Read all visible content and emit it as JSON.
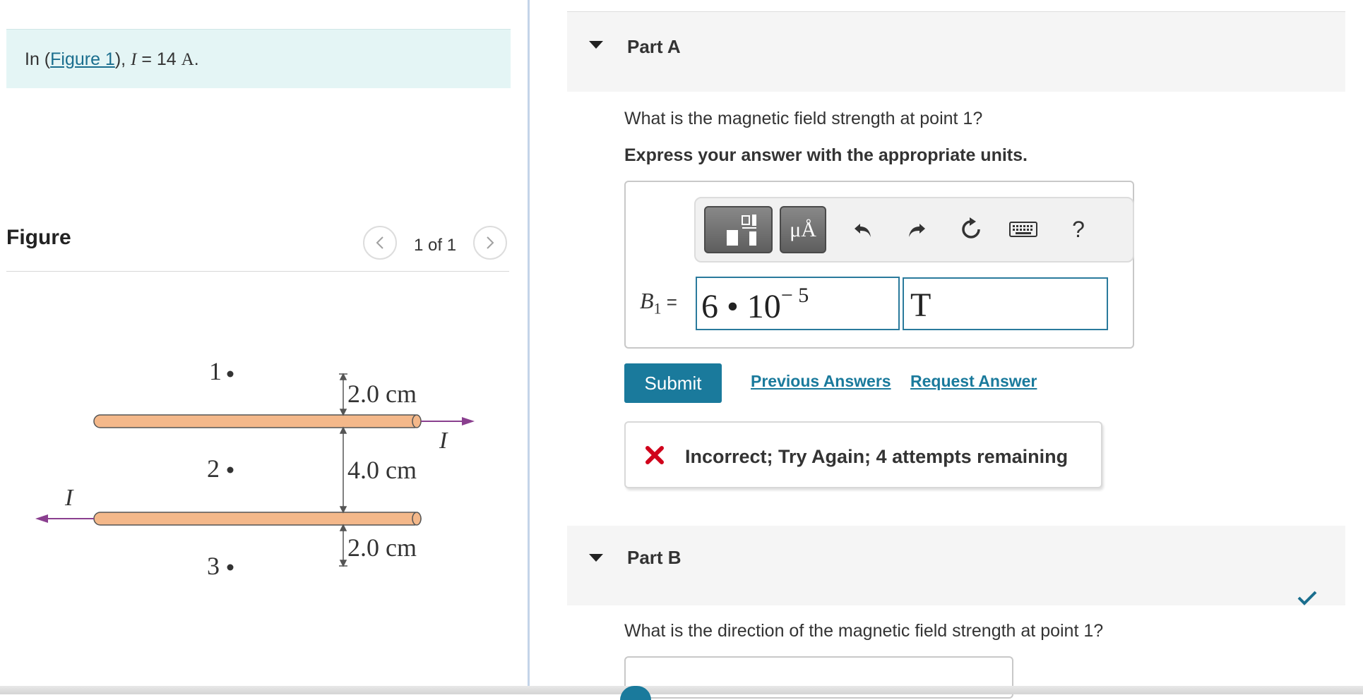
{
  "problem": {
    "prefix": "In (",
    "link": "Figure 1",
    "suffix_open": "), ",
    "var": "I",
    "eq": " = 14 ",
    "unit": "A",
    "period": "."
  },
  "figure": {
    "heading": "Figure",
    "pager": "1 of 1",
    "labels": {
      "point1": "1",
      "point2": "2",
      "point3": "3",
      "dim_top": "2.0 cm",
      "dim_mid": "4.0 cm",
      "dim_bottom": "2.0 cm",
      "current_right": "I",
      "current_left": "I"
    }
  },
  "part_a": {
    "title": "Part A",
    "question": "What is the magnetic field strength at point 1?",
    "instruction": "Express your answer with the appropriate units.",
    "toolbar": {
      "units_label": "μÅ",
      "help_label": "?"
    },
    "variable": "B",
    "subscript": "1",
    "equals": " =",
    "value_base": "6 • 10",
    "value_exponent": "− 5",
    "units_value": "T",
    "submit_label": "Submit",
    "previous_answers_label": "Previous Answers",
    "request_answer_label": "Request Answer",
    "feedback": "Incorrect; Try Again; 4 attempts remaining"
  },
  "part_b": {
    "title": "Part B",
    "question": "What is the direction of the magnetic field strength at point 1?"
  },
  "colors": {
    "accent": "#1a7a9c",
    "error": "#d0021b",
    "success": "#1a6e8e",
    "problem_bg": "#e4f5f5",
    "wire": "#f4b88a",
    "arrow": "#8a3f8f"
  }
}
